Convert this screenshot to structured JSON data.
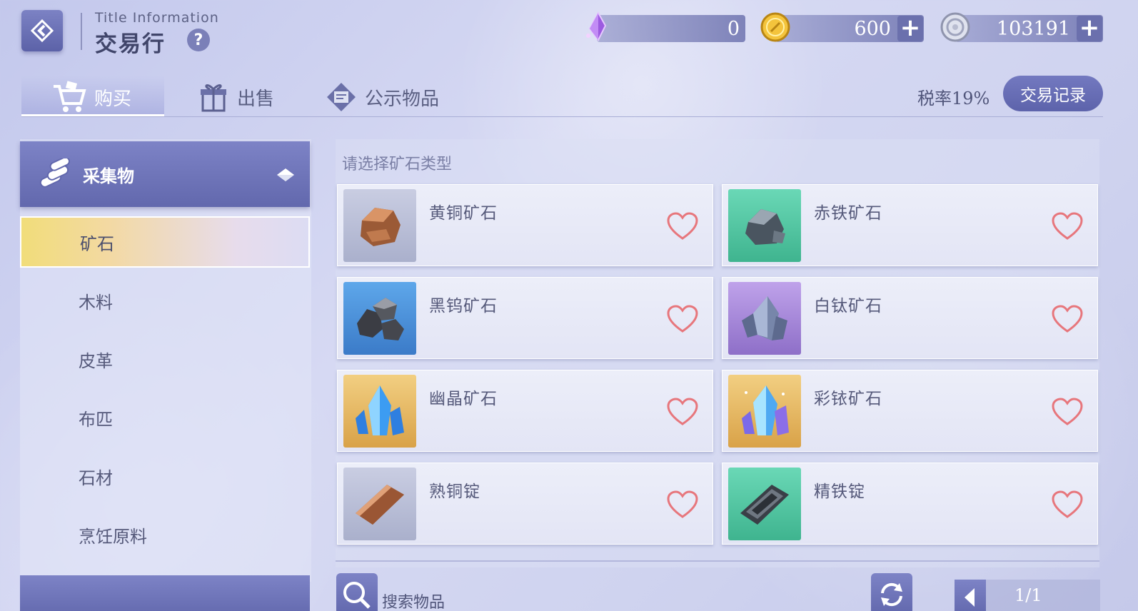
{
  "header": {
    "title_en": "Title  Information",
    "title_cn": "交易行",
    "help": "?"
  },
  "currencies": [
    {
      "name": "crystal",
      "icon": "purple-crystal-icon",
      "amount": "0",
      "has_plus": false
    },
    {
      "name": "gold",
      "icon": "gold-coin-icon",
      "amount": "600",
      "has_plus": true
    },
    {
      "name": "silver",
      "icon": "silver-coin-icon",
      "amount": "103191",
      "has_plus": true
    }
  ],
  "tabs": [
    {
      "label": "购买",
      "icon": "cart-icon",
      "active": true
    },
    {
      "label": "出售",
      "icon": "gift-box-icon",
      "active": false
    },
    {
      "label": "公示物品",
      "icon": "notice-board-icon",
      "active": false
    }
  ],
  "tax_label": "税率19%",
  "trade_log_label": "交易记录",
  "sidebar": {
    "category": "采集物",
    "items": [
      {
        "label": "矿石",
        "active": true
      },
      {
        "label": "木料",
        "active": false
      },
      {
        "label": "皮革",
        "active": false
      },
      {
        "label": "布匹",
        "active": false
      },
      {
        "label": "石材",
        "active": false
      },
      {
        "label": "烹饪原料",
        "active": false
      }
    ]
  },
  "main": {
    "prompt": "请选择矿石类型",
    "items": [
      {
        "name": "黄铜矿石",
        "icon": "copper-ore-icon",
        "bg": "#b9bfd8"
      },
      {
        "name": "赤铁矿石",
        "icon": "iron-ore-icon",
        "bg": "#55c9a6"
      },
      {
        "name": "黑钨矿石",
        "icon": "tungsten-ore-icon",
        "bg": "#4a8fd6"
      },
      {
        "name": "白钛矿石",
        "icon": "titanium-ore-icon",
        "bg": "#a88ad6"
      },
      {
        "name": "幽晶矿石",
        "icon": "blue-crystal-ore-icon",
        "bg": "#e6b760"
      },
      {
        "name": "彩铱矿石",
        "icon": "rainbow-crystal-ore-icon",
        "bg": "#e6b760"
      },
      {
        "name": "熟铜锭",
        "icon": "copper-ingot-icon",
        "bg": "#b9bfd8"
      },
      {
        "name": "精铁锭",
        "icon": "iron-ingot-icon",
        "bg": "#55c9a6"
      }
    ]
  },
  "footer": {
    "search_label": "搜索物品",
    "page_text": "1/1"
  },
  "colors": {
    "accent": "#6268ad",
    "heart": "#e7767c",
    "active_yellow": "#f1dd7a"
  }
}
